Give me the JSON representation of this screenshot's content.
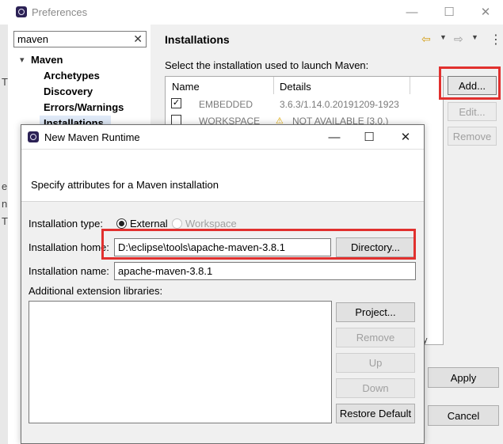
{
  "preferences": {
    "title": "Preferences",
    "window_controls": [
      "—",
      "☐",
      "✕"
    ],
    "filter_value": "maven",
    "tree": {
      "root": "Maven",
      "children": [
        "Archetypes",
        "Discovery",
        "Errors/Warnings",
        "Installations"
      ],
      "selected": "Installations"
    },
    "page_title": "Installations",
    "description": "Select the installation used to launch Maven:",
    "table": {
      "columns": [
        "Name",
        "Details"
      ],
      "rows": [
        {
          "checked": true,
          "name": "EMBEDDED",
          "details": "3.6.3/1.14.0.20191209-1923"
        },
        {
          "checked": false,
          "name": "WORKSPACE",
          "details": "NOT AVAILABLE [3.0,)",
          "warning": true
        }
      ]
    },
    "buttons": {
      "add": "Add...",
      "edit": "Edit...",
      "remove": "Remove",
      "apply": "Apply",
      "cancel": "Cancel"
    },
    "stray_chars": {
      "right_edge": "y",
      "left_1": "T",
      "left_2": "e",
      "left_3": "n",
      "left_4": "T"
    }
  },
  "dialog": {
    "title": "New Maven Runtime",
    "window_controls": [
      "—",
      "☐",
      "✕"
    ],
    "description": "Specify attributes for a Maven installation",
    "installation_type_label": "Installation type:",
    "type_options": [
      {
        "label": "External",
        "selected": true,
        "enabled": true
      },
      {
        "label": "Workspace",
        "selected": false,
        "enabled": false
      }
    ],
    "home_label": "Installation home:",
    "home_value": "D:\\eclipse\\tools\\apache-maven-3.8.1",
    "directory_button": "Directory...",
    "name_label": "Installation name:",
    "name_value": "apache-maven-3.8.1",
    "libraries_label": "Additional extension libraries:",
    "library_buttons": {
      "project": "Project...",
      "remove": "Remove",
      "up": "Up",
      "down": "Down",
      "restore": "Restore Default"
    }
  },
  "colors": {
    "highlight": "#e1302e",
    "selection": "#dfe9f7",
    "warning": "#e0a800"
  }
}
